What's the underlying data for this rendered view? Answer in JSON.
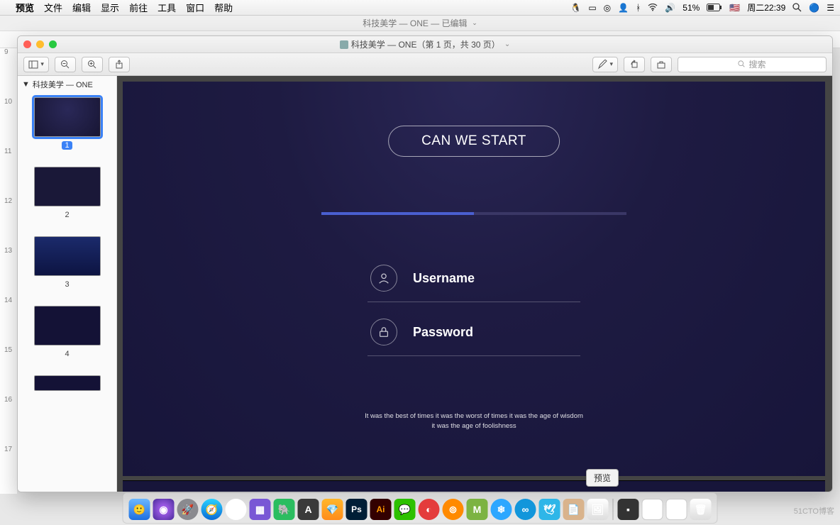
{
  "menubar": {
    "app": "预览",
    "items": [
      "文件",
      "编辑",
      "显示",
      "前往",
      "工具",
      "窗口",
      "帮助"
    ],
    "battery": "51%",
    "clock": "周二22:39"
  },
  "bg_window_title": "科技美学 — ONE — 已编辑",
  "preview": {
    "title": "科技美学 — ONE（第 1 页，共 30 页）",
    "search_placeholder": "搜索",
    "sidebar_title": "科技美学 — ONE",
    "pages": [
      "1",
      "2",
      "3",
      "4"
    ]
  },
  "slide": {
    "cta": "CAN WE START",
    "username": "Username",
    "password": "Password",
    "quote_l1": "It was the best of times it was the worst of times  it was the age of wisdom",
    "quote_l2": "it was the age of foolishness"
  },
  "tooltip": "预览",
  "gutter": [
    "9",
    "10",
    "11",
    "12",
    "13",
    "14",
    "15",
    "16",
    "17"
  ],
  "watermark": "51CTO博客"
}
